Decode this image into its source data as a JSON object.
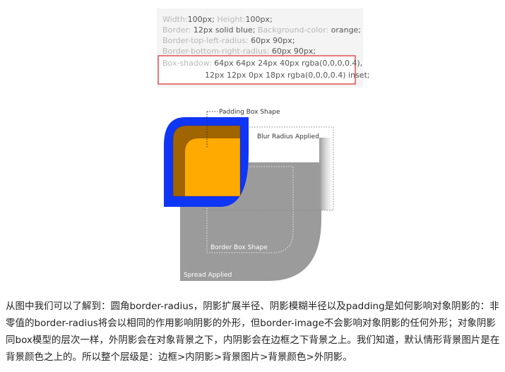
{
  "code_block": {
    "lines": [
      [
        {
          "k": "Width:",
          "v": "100px; "
        },
        {
          "k": "Height:",
          "v": "100px;"
        }
      ],
      [
        {
          "k": "Border:",
          "v": " 12px solid blue; "
        },
        {
          "k": "Background-color:",
          "v": " orange;"
        }
      ],
      [
        {
          "k": "Border-top-left-radius:",
          "v": "  60px 90px;"
        }
      ],
      [
        {
          "k": "Border-bottom-right-radius:",
          "v": "  60px 90px;"
        }
      ]
    ],
    "shadow_label": "Box-shadow:",
    "shadow_value_1": " 64px 64px 24px 40px rgba(0,0,0,0.4),",
    "shadow_value_2": "12px 12px 0px 18px rgba(0,0,0,0.4) inset;"
  },
  "diagram": {
    "padding_box_label": "Padding Box Shape",
    "blur_label": "Blur Radius Applied",
    "border_box_label": "Border Box Shape",
    "spread_label": "Spread Applied"
  },
  "colors": {
    "border_blue": "#0f35f5",
    "background_orange": "#ffaa00",
    "inset_shadow": "#a06400",
    "outer_shadow_gray": "#999999",
    "highlight_red": "#e05050"
  },
  "caption": "从图中我们可以了解到：圆角border-radius，阴影扩展半径、阴影模糊半径以及padding是如何影响对象阴影的：非零值的border-radius将会以相同的作用影响阴影的外形，但border-image不会影响对象阴影的任何外形；对象阴影同box模型的层次一样，外阴影会在对象背景之下，内阴影会在边框之下背景之上。我们知道，默认情形背景图片是在背景颜色之上的。所以整个层级是：边框>内阴影>背景图片>背景颜色>外阴影。"
}
